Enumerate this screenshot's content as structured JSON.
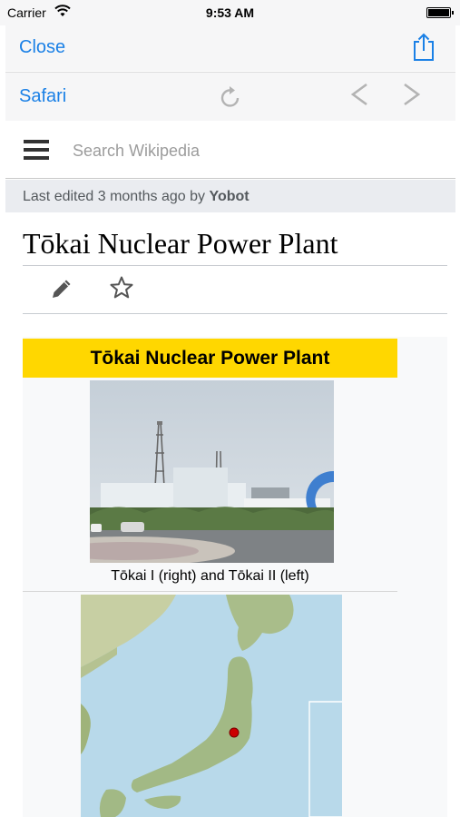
{
  "status": {
    "carrier": "Carrier",
    "time": "9:53 AM"
  },
  "toolbar": {
    "close_label": "Close",
    "safari_label": "Safari"
  },
  "search": {
    "placeholder": "Search Wikipedia",
    "value": ""
  },
  "last_edited": {
    "prefix": "Last edited 3 months ago by",
    "user": "Yobot"
  },
  "article": {
    "title": "Tōkai Nuclear Power Plant"
  },
  "infobox": {
    "title": "Tōkai Nuclear Power Plant",
    "photo_caption": "Tōkai I (right) and Tōkai II (left)"
  },
  "colors": {
    "accent": "#1a80e6",
    "infobox_header": "#ffd700",
    "map_marker": "#cc0000"
  },
  "icons": [
    "wifi-icon",
    "battery-icon",
    "share-icon",
    "reload-icon",
    "back-arrow-icon",
    "forward-arrow-icon",
    "menu-icon",
    "edit-pencil-icon",
    "star-icon",
    "map-marker-icon"
  ]
}
